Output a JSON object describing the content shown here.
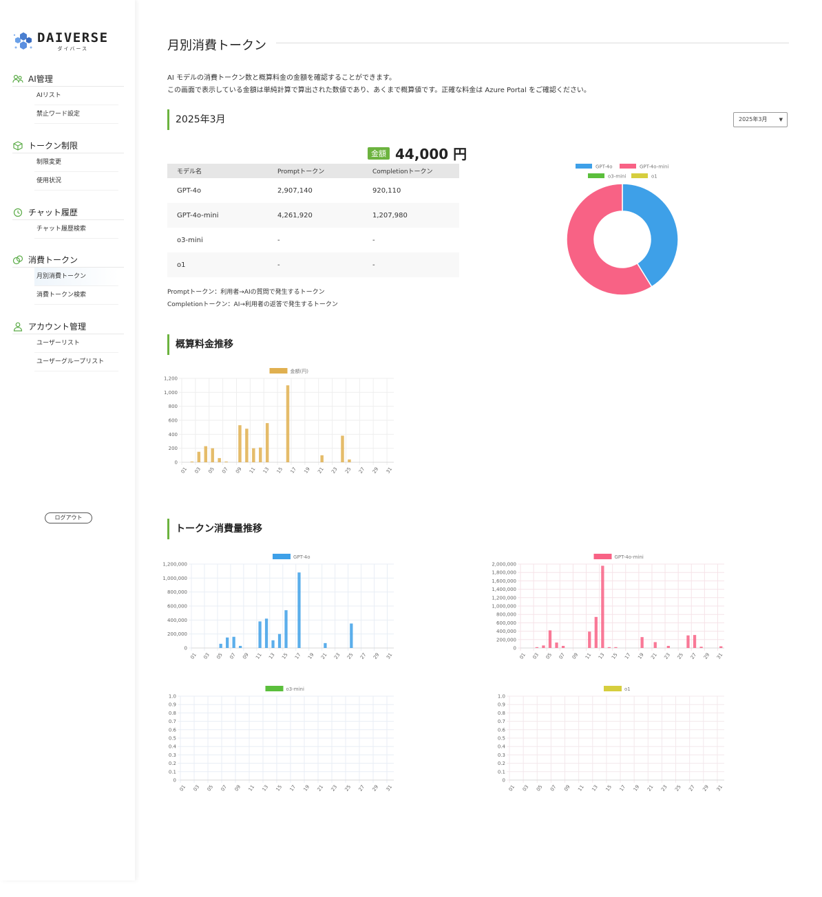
{
  "brand": {
    "name": "DAIVERSE",
    "sub": "ダイバース"
  },
  "sidebar": {
    "sections": [
      {
        "title": "AI管理",
        "icon": "people-icon",
        "items": [
          {
            "label": "AIリスト"
          },
          {
            "label": "禁止ワード設定"
          }
        ]
      },
      {
        "title": "トークン制限",
        "icon": "box-icon",
        "items": [
          {
            "label": "制限変更"
          },
          {
            "label": "使用状況"
          }
        ]
      },
      {
        "title": "チャット履歴",
        "icon": "history-icon",
        "items": [
          {
            "label": "チャット履歴検索"
          }
        ]
      },
      {
        "title": "消費トークン",
        "icon": "coins-icon",
        "items": [
          {
            "label": "月別消費トークン",
            "active": true
          },
          {
            "label": "消費トークン検索"
          }
        ]
      },
      {
        "title": "アカウント管理",
        "icon": "person-icon",
        "items": [
          {
            "label": "ユーザーリスト"
          },
          {
            "label": "ユーザーグループリスト"
          }
        ]
      }
    ],
    "logout": "ログアウト"
  },
  "page": {
    "title": "月別消費トークン",
    "desc1": "AI モデルの消費トークン数と概算料金の金額を確認することができます。",
    "desc2": "この画面で表示している金額は単純計算で算出された数値であり、あくまで概算値です。正確な料金は Azure Portal をご確認ください。"
  },
  "month": {
    "title": "2025年3月",
    "select": "2025年3月"
  },
  "amount": {
    "badge": "金額",
    "value": "44,000 円"
  },
  "table": {
    "headers": [
      "モデル名",
      "Promptトークン",
      "Completionトークン"
    ],
    "rows": [
      [
        "GPT-4o",
        "2,907,140",
        "920,110"
      ],
      [
        "GPT-4o-mini",
        "4,261,920",
        "1,207,980"
      ],
      [
        "o3-mini",
        "-",
        "-"
      ],
      [
        "o1",
        "-",
        "-"
      ]
    ]
  },
  "notes": {
    "prompt": "Promptトークン：利用者→AIの質問で発生するトークン",
    "completion": "Completionトークン：AI→利用者の返答で発生するトークン"
  },
  "sections": {
    "cost": "概算料金推移",
    "tokens": "トークン消費量推移"
  },
  "colors": {
    "accent": "#6cb33f",
    "gpt4o": "#3ea0e8",
    "gpt4omini": "#f86285",
    "o3mini": "#5bbf3c",
    "o1": "#d6ce3e",
    "cost": "#e0b050"
  },
  "chart_data": [
    {
      "id": "doughnut",
      "type": "pie",
      "legend": [
        "GPT-4o",
        "GPT-4o-mini",
        "o3-mini",
        "o1"
      ],
      "values": [
        3827250,
        5469900,
        0,
        0
      ]
    },
    {
      "id": "cost",
      "type": "bar",
      "series_name": "金額(円)",
      "x": [
        "01",
        "02",
        "03",
        "04",
        "05",
        "06",
        "07",
        "08",
        "09",
        "10",
        "11",
        "12",
        "13",
        "14",
        "15",
        "16",
        "17",
        "18",
        "19",
        "20",
        "21",
        "22",
        "23",
        "24",
        "25",
        "26",
        "27",
        "28",
        "29",
        "30",
        "31"
      ],
      "ticks": [
        "01",
        "03",
        "05",
        "07",
        "09",
        "11",
        "13",
        "15",
        "17",
        "19",
        "21",
        "23",
        "25",
        "27",
        "29",
        "31"
      ],
      "values": [
        0,
        10,
        150,
        230,
        200,
        60,
        10,
        0,
        530,
        480,
        200,
        210,
        560,
        0,
        0,
        1100,
        0,
        0,
        0,
        0,
        100,
        0,
        0,
        380,
        40,
        0,
        0,
        0,
        0,
        0,
        0
      ],
      "yticks": [
        "0",
        "200",
        "400",
        "600",
        "800",
        "1,000",
        "1,200"
      ],
      "ylim": [
        0,
        1200
      ]
    },
    {
      "id": "gpt4o",
      "type": "bar",
      "series_name": "GPT-4o",
      "x": [
        "01",
        "02",
        "03",
        "04",
        "05",
        "06",
        "07",
        "08",
        "09",
        "10",
        "11",
        "12",
        "13",
        "14",
        "15",
        "16",
        "17",
        "18",
        "19",
        "20",
        "21",
        "22",
        "23",
        "24",
        "25",
        "26",
        "27",
        "28",
        "29",
        "30",
        "31"
      ],
      "ticks": [
        "01",
        "03",
        "05",
        "07",
        "09",
        "11",
        "13",
        "15",
        "17",
        "19",
        "21",
        "23",
        "25",
        "27",
        "29",
        "31"
      ],
      "values": [
        0,
        0,
        0,
        0,
        60000,
        150000,
        160000,
        30000,
        0,
        0,
        380000,
        420000,
        110000,
        200000,
        540000,
        0,
        1080000,
        0,
        0,
        0,
        70000,
        0,
        0,
        0,
        350000,
        0,
        0,
        0,
        0,
        0,
        0
      ],
      "yticks": [
        "0",
        "200,000",
        "400,000",
        "600,000",
        "800,000",
        "1,000,000",
        "1,200,000"
      ],
      "ylim": [
        0,
        1200000
      ]
    },
    {
      "id": "gpt4omini",
      "type": "bar",
      "series_name": "GPT-4o-mini",
      "x": [
        "01",
        "02",
        "03",
        "04",
        "05",
        "06",
        "07",
        "08",
        "09",
        "10",
        "11",
        "12",
        "13",
        "14",
        "15",
        "16",
        "17",
        "18",
        "19",
        "20",
        "21",
        "22",
        "23",
        "24",
        "25",
        "26",
        "27",
        "28",
        "29",
        "30",
        "31"
      ],
      "ticks": [
        "01",
        "03",
        "05",
        "07",
        "09",
        "11",
        "13",
        "15",
        "17",
        "19",
        "21",
        "23",
        "25",
        "27",
        "29",
        "31"
      ],
      "values": [
        0,
        0,
        20000,
        60000,
        420000,
        130000,
        50000,
        0,
        0,
        0,
        390000,
        740000,
        1960000,
        20000,
        20000,
        0,
        0,
        0,
        260000,
        0,
        140000,
        0,
        50000,
        0,
        0,
        300000,
        310000,
        30000,
        0,
        0,
        40000
      ],
      "yticks": [
        "0",
        "200,000",
        "400,000",
        "600,000",
        "800,000",
        "1,000,000",
        "1,200,000",
        "1,400,000",
        "1,600,000",
        "1,800,000",
        "2,000,000"
      ],
      "ylim": [
        0,
        2000000
      ]
    },
    {
      "id": "o3mini",
      "type": "bar",
      "series_name": "o3-mini",
      "x": [
        "01",
        "02",
        "03",
        "04",
        "05",
        "06",
        "07",
        "08",
        "09",
        "10",
        "11",
        "12",
        "13",
        "14",
        "15",
        "16",
        "17",
        "18",
        "19",
        "20",
        "21",
        "22",
        "23",
        "24",
        "25",
        "26",
        "27",
        "28",
        "29",
        "30",
        "31"
      ],
      "ticks": [
        "01",
        "03",
        "05",
        "07",
        "09",
        "11",
        "13",
        "15",
        "17",
        "19",
        "21",
        "23",
        "25",
        "27",
        "29",
        "31"
      ],
      "values": [
        0,
        0,
        0,
        0,
        0,
        0,
        0,
        0,
        0,
        0,
        0,
        0,
        0,
        0,
        0,
        0,
        0,
        0,
        0,
        0,
        0,
        0,
        0,
        0,
        0,
        0,
        0,
        0,
        0,
        0,
        0
      ],
      "yticks": [
        "0",
        "0.1",
        "0.2",
        "0.3",
        "0.4",
        "0.5",
        "0.6",
        "0.7",
        "0.8",
        "0.9",
        "1.0"
      ],
      "ylim": [
        0,
        1
      ]
    },
    {
      "id": "o1",
      "type": "bar",
      "series_name": "o1",
      "x": [
        "01",
        "02",
        "03",
        "04",
        "05",
        "06",
        "07",
        "08",
        "09",
        "10",
        "11",
        "12",
        "13",
        "14",
        "15",
        "16",
        "17",
        "18",
        "19",
        "20",
        "21",
        "22",
        "23",
        "24",
        "25",
        "26",
        "27",
        "28",
        "29",
        "30",
        "31"
      ],
      "ticks": [
        "01",
        "03",
        "05",
        "07",
        "09",
        "11",
        "13",
        "15",
        "17",
        "19",
        "21",
        "23",
        "25",
        "27",
        "29",
        "31"
      ],
      "values": [
        0,
        0,
        0,
        0,
        0,
        0,
        0,
        0,
        0,
        0,
        0,
        0,
        0,
        0,
        0,
        0,
        0,
        0,
        0,
        0,
        0,
        0,
        0,
        0,
        0,
        0,
        0,
        0,
        0,
        0,
        0
      ],
      "yticks": [
        "0",
        "0.1",
        "0.2",
        "0.3",
        "0.4",
        "0.5",
        "0.6",
        "0.7",
        "0.8",
        "0.9",
        "1.0"
      ],
      "ylim": [
        0,
        1
      ]
    }
  ]
}
